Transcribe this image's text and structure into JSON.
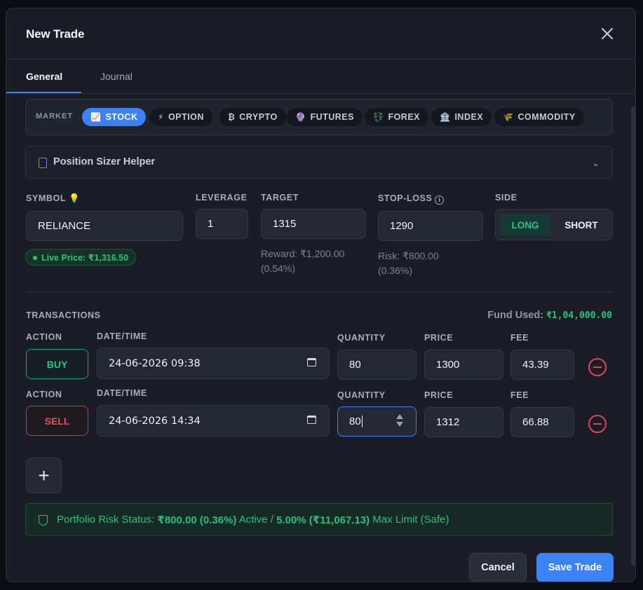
{
  "modal": {
    "title": "New Trade",
    "tabs": [
      {
        "label": "General",
        "active": true
      },
      {
        "label": "Journal",
        "active": false
      }
    ]
  },
  "market": {
    "label": "MARKET",
    "options": [
      {
        "label": "STOCK",
        "icon": "chart-icon",
        "glyph": "📈",
        "active": true
      },
      {
        "label": "OPTION",
        "icon": "lightning-icon",
        "glyph": "⚡",
        "active": false
      },
      {
        "label": "CRYPTO",
        "icon": "bitcoin-icon",
        "glyph": "₿",
        "active": false
      },
      {
        "label": "FUTURES",
        "icon": "crystal-ball-icon",
        "glyph": "🔮",
        "active": false
      },
      {
        "label": "FOREX",
        "icon": "exchange-icon",
        "glyph": "💱",
        "active": false
      },
      {
        "label": "INDEX",
        "icon": "bank-icon",
        "glyph": "🏦",
        "active": false
      },
      {
        "label": "COMMODITY",
        "icon": "wheat-icon",
        "glyph": "🌾",
        "active": false
      }
    ]
  },
  "position_sizer": {
    "label": "Position Sizer Helper"
  },
  "fields": {
    "symbol": {
      "label": "SYMBOL",
      "value": "RELIANCE",
      "live_price": "Live Price: ₹1,316.50"
    },
    "leverage": {
      "label": "LEVERAGE",
      "value": "1"
    },
    "target": {
      "label": "TARGET",
      "value": "1315",
      "reward_line1": "Reward: ₹1,200.00",
      "reward_line2": "(0.54%)"
    },
    "stop_loss": {
      "label": "STOP-LOSS",
      "value": "1290",
      "risk_line1": "Risk: ₹800.00",
      "risk_line2": "(0.36%)"
    },
    "side": {
      "label": "SIDE",
      "long": "LONG",
      "short": "SHORT",
      "selected": "LONG"
    }
  },
  "transactions": {
    "label": "TRANSACTIONS",
    "fund_used_label": "Fund Used:",
    "fund_used_value": "₹1,04,000.00",
    "col_action": "ACTION",
    "col_datetime": "DATE/TIME",
    "col_quantity": "QUANTITY",
    "col_price": "PRICE",
    "col_fee": "FEE",
    "rows": [
      {
        "action": "BUY",
        "datetime": "24-06-2026 09:38",
        "quantity": "80",
        "price": "1300",
        "fee": "43.39"
      },
      {
        "action": "SELL",
        "datetime": "24-06-2026 14:34",
        "quantity": "80",
        "price": "1312",
        "fee": "66.88"
      }
    ],
    "add_label": "+"
  },
  "risk_status": {
    "prefix": "Portfolio Risk Status: ",
    "current": "₹800.00 (0.36%)",
    "mid": " Active / ",
    "limit": "5.00% (₹11,067.13)",
    "suffix": " Max Limit (Safe)"
  },
  "actions": {
    "cancel": "Cancel",
    "save": "Save Trade"
  },
  "colors": {
    "accent": "#3b82f6",
    "positive": "#22c77a",
    "negative": "#ef4b5c"
  }
}
